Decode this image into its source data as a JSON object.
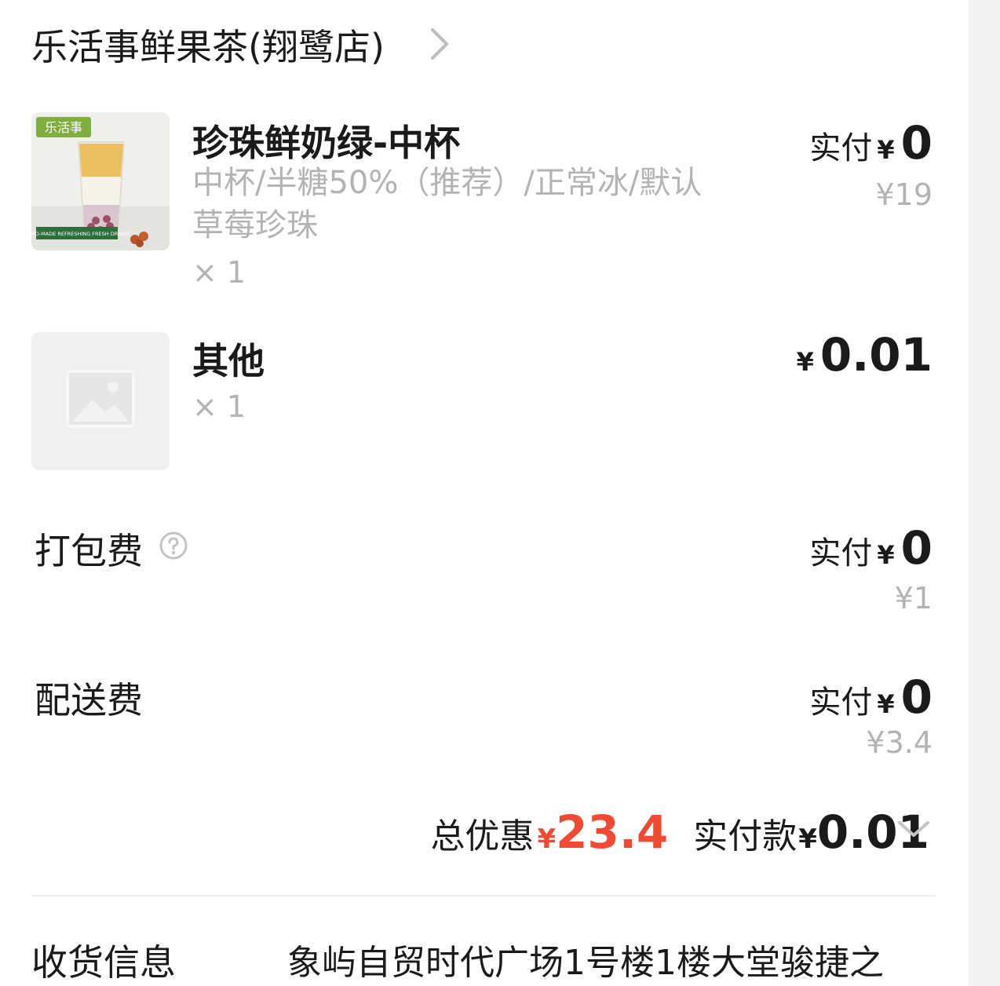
{
  "store": {
    "name": "乐活事鲜果茶(翔鹭店)"
  },
  "items": [
    {
      "name": "珍珠鲜奶绿-中杯",
      "specs": "中杯/半糖50%（推荐）/正常冰/默认草莓珍珠",
      "quantity": "× 1",
      "paid_label": "实付",
      "currency": "¥",
      "paid_amount": "0",
      "original_price": "¥19",
      "thumb_brand": "乐活事",
      "thumb_tagline": "HAND-MADE REFRESHING FRESH DRINKS"
    },
    {
      "name": "其他",
      "quantity": "× 1",
      "currency": "¥",
      "price": "0.01",
      "thumb": "image-placeholder-icon"
    }
  ],
  "fees": [
    {
      "label": "打包费",
      "has_help": true,
      "paid_label": "实付",
      "currency": "¥",
      "paid_amount": "0",
      "original": "¥1"
    },
    {
      "label": "配送费",
      "has_help": false,
      "paid_label": "实付",
      "currency": "¥",
      "paid_amount": "0",
      "original": "¥3.4"
    }
  ],
  "summary": {
    "discount_label": "总优惠",
    "discount_currency": "¥",
    "discount_amount": "23.4",
    "total_label": "实付款",
    "total_currency": "¥",
    "total_amount": "0.01"
  },
  "delivery": {
    "label": "收货信息",
    "address": "象屿自贸时代广场1号楼1楼大堂骏捷之"
  },
  "colors": {
    "accent_red": "#f04b32",
    "muted_text": "#b3b3b3",
    "primary_text": "#1a1a1a"
  },
  "icons": [
    "chevron-right-icon",
    "help-circle-icon",
    "image-placeholder-icon",
    "chevron-down-icon"
  ]
}
